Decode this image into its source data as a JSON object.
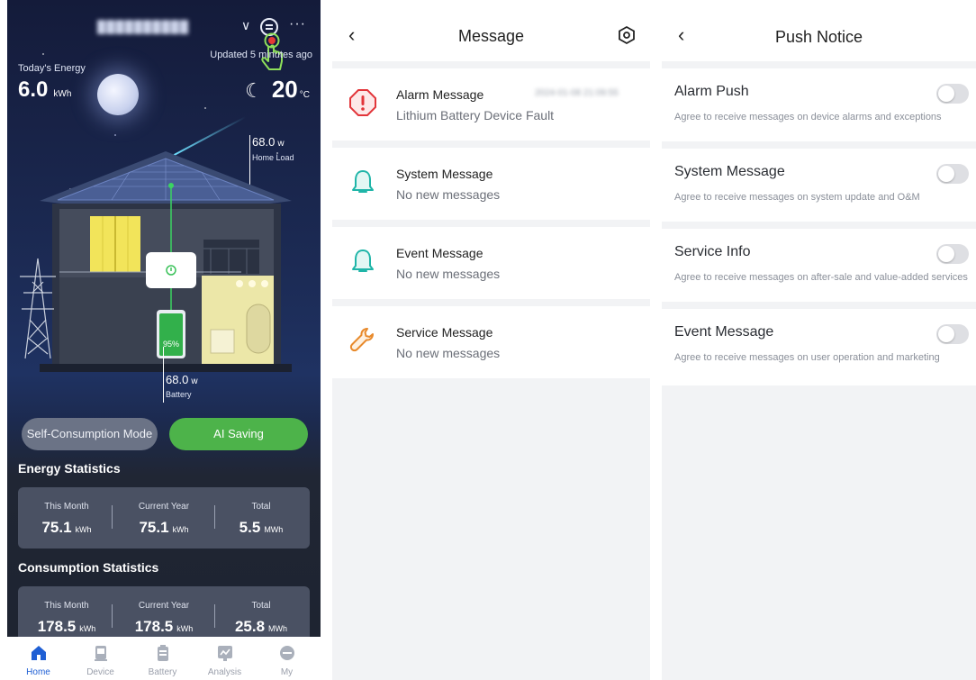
{
  "home": {
    "site_name": "██████████",
    "more_label": "···",
    "updated": "Updated 5 minutes ago",
    "today_energy_label": "Today's Energy",
    "today_energy_value": "6.0",
    "today_energy_unit": "kWh",
    "temperature_value": "20",
    "temperature_unit": "°C",
    "home_load_value": "68.0",
    "home_load_unit": "w",
    "home_load_label": "Home Load",
    "battery_value": "68.0",
    "battery_unit": "w",
    "battery_label": "Battery",
    "battery_soc": "95%",
    "modes": [
      "Self-Consumption Mode",
      "AI Saving"
    ],
    "energy_title": "Energy Statistics",
    "energy_stats": [
      {
        "label": "This Month",
        "value": "75.1",
        "unit": "kWh"
      },
      {
        "label": "Current Year",
        "value": "75.1",
        "unit": "kWh"
      },
      {
        "label": "Total",
        "value": "5.5",
        "unit": "MWh"
      }
    ],
    "consumption_title": "Consumption Statistics",
    "consumption_stats": [
      {
        "label": "This Month",
        "value": "178.5",
        "unit": "kWh"
      },
      {
        "label": "Current Year",
        "value": "178.5",
        "unit": "kWh"
      },
      {
        "label": "Total",
        "value": "25.8",
        "unit": "MWh"
      }
    ],
    "tabs": [
      "Home",
      "Device",
      "Battery",
      "Analysis",
      "My"
    ],
    "active_tab": "Home"
  },
  "message": {
    "back": "‹",
    "title": "Message",
    "items": [
      {
        "title": "Alarm Message",
        "subtitle": "Lithium Battery Device Fault",
        "date": "2024-01-08 21:09:55",
        "icon": "alarm-icon"
      },
      {
        "title": "System Message",
        "subtitle": "No new messages",
        "icon": "bell-icon"
      },
      {
        "title": "Event Message",
        "subtitle": "No new messages",
        "icon": "bell-icon"
      },
      {
        "title": "Service Message",
        "subtitle": "No new messages",
        "icon": "wrench-icon"
      }
    ]
  },
  "push": {
    "back": "‹",
    "title": "Push Notice",
    "items": [
      {
        "title": "Alarm Push",
        "desc": "Agree to receive messages on device alarms and exceptions",
        "enabled": false
      },
      {
        "title": "System Message",
        "desc": "Agree to receive messages on system update and O&M",
        "enabled": false
      },
      {
        "title": "Service Info",
        "desc": "Agree to receive messages on after-sale and value-added services",
        "enabled": false
      },
      {
        "title": "Event Message",
        "desc": "Agree to receive messages on user operation and marketing",
        "enabled": false
      }
    ]
  },
  "colors": {
    "accent_green": "#4db34a",
    "alarm_red": "#e2353a",
    "bell_teal": "#1fb5a8",
    "wrench_orange": "#e88a2c",
    "tab_active_blue": "#1f5fd4"
  }
}
